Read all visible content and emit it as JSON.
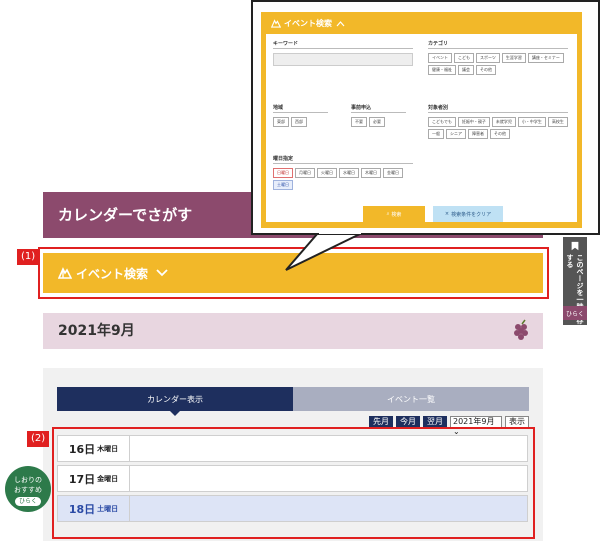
{
  "page": {
    "title": "カレンダーでさがす",
    "label1": "(1)",
    "label2": "(2)"
  },
  "search_bar": {
    "label": "イベント検索"
  },
  "month": {
    "label": "2021年9月"
  },
  "tabs": [
    {
      "label": "カレンダー表示",
      "active": true
    },
    {
      "label": "イベント一覧",
      "active": false
    }
  ],
  "nav": {
    "prev": "先月",
    "today": "今月",
    "next": "翌月",
    "select_value": "2021年9月",
    "go": "表示"
  },
  "days": [
    {
      "day": "16日",
      "weekday": "木曜日",
      "type": "weekday"
    },
    {
      "day": "17日",
      "weekday": "金曜日",
      "type": "weekday"
    },
    {
      "day": "18日",
      "weekday": "土曜日",
      "type": "sat"
    }
  ],
  "side_tab": {
    "text": "このページを一時保存する",
    "open": "ひらく"
  },
  "bookmark_bubble": {
    "line1": "しおりの",
    "line2": "おすすめ",
    "open": "ひらく"
  },
  "popup": {
    "title": "イベント検索",
    "keyword_label": "キーワード",
    "category_label": "カテゴリ",
    "categories": [
      "イベント",
      "こども",
      "スポーツ",
      "生涯学習",
      "講座・セミナー",
      "健康・福祉",
      "議会",
      "その他"
    ],
    "area_label": "地域",
    "areas": [
      "東部",
      "西部"
    ],
    "fee_label": "事前申込",
    "fees": [
      "不要",
      "必要"
    ],
    "target_label": "対象者別",
    "targets": [
      "こどもでも",
      "妊娠中・親子",
      "未就学児",
      "小・中学生",
      "高校生",
      "一般",
      "シニア",
      "障害者",
      "その他"
    ],
    "weekday_label": "曜日指定",
    "weekdays": [
      "日曜日",
      "月曜日",
      "火曜日",
      "水曜日",
      "木曜日",
      "金曜日",
      "土曜日"
    ],
    "search_btn": "検索",
    "clear_btn": "検索条件をクリア"
  },
  "colors": {
    "accent_yellow": "#f2b829",
    "brand_purple": "#8c4a6d",
    "navy": "#1e2f5e",
    "red_frame": "#e02020"
  }
}
